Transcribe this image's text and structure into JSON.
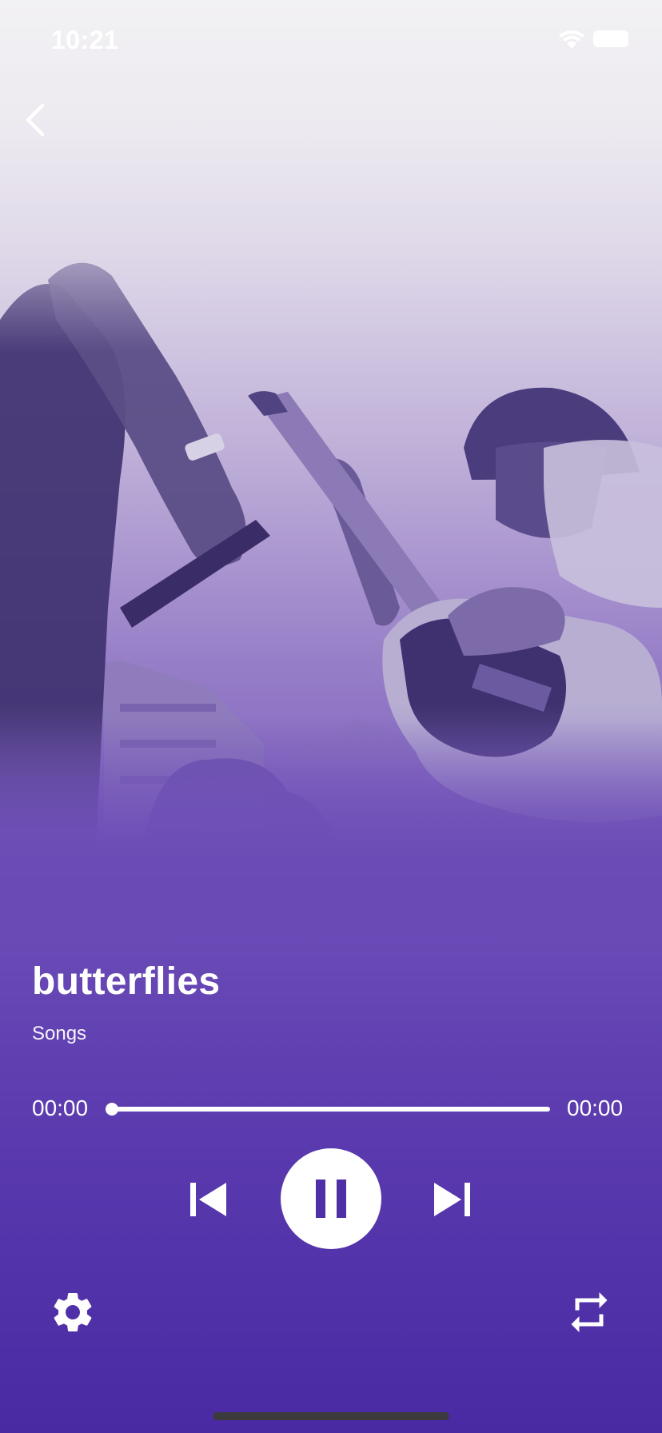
{
  "status_bar": {
    "time": "10:21",
    "wifi_icon": "wifi-icon",
    "battery_icon": "battery-icon"
  },
  "nav": {
    "back_icon": "chevron-left-icon"
  },
  "artwork": {
    "description_icon": "album-artwork"
  },
  "track": {
    "title": "butterflies",
    "subtitle": "Songs"
  },
  "progress": {
    "current_time": "00:00",
    "total_time": "00:00",
    "fraction": 0
  },
  "controls": {
    "previous_icon": "skip-previous-icon",
    "pause_icon": "pause-icon",
    "next_icon": "skip-next-icon",
    "settings_icon": "gear-icon",
    "repeat_icon": "repeat-icon"
  },
  "colors": {
    "accent": "#6a4bb6",
    "bottom": "#4a2aa3",
    "foreground": "#ffffff"
  }
}
